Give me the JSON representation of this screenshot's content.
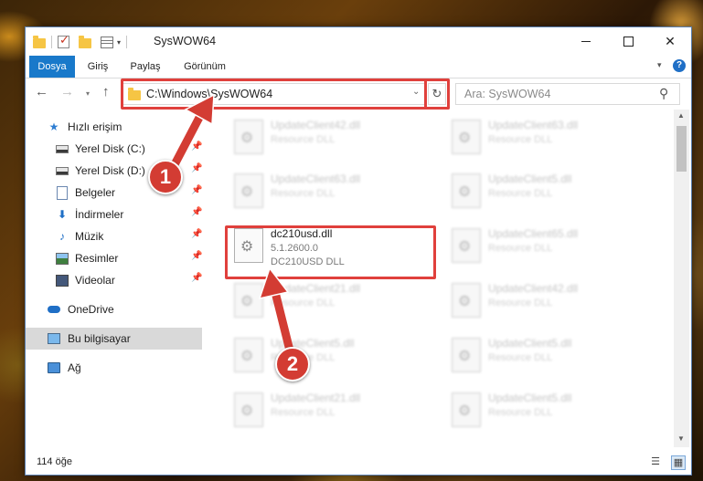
{
  "window": {
    "title": "SysWOW64"
  },
  "ribbon": {
    "tabs": [
      "Dosya",
      "Giriş",
      "Paylaş",
      "Görünüm"
    ],
    "help_label": "?"
  },
  "nav": {
    "address": "C:\\Windows\\SysWOW64",
    "search_placeholder": "Ara: SysWOW64"
  },
  "sidebar": {
    "items": [
      {
        "label": "Hızlı erişim",
        "icon": "star-icon"
      },
      {
        "label": "Yerel Disk (C:)",
        "icon": "drive-icon"
      },
      {
        "label": "Yerel Disk (D:)",
        "icon": "drive-icon"
      },
      {
        "label": "Belgeler",
        "icon": "documents-icon"
      },
      {
        "label": "İndirmeler",
        "icon": "downloads-icon"
      },
      {
        "label": "Müzik",
        "icon": "music-icon"
      },
      {
        "label": "Resimler",
        "icon": "pictures-icon"
      },
      {
        "label": "Videolar",
        "icon": "videos-icon"
      },
      {
        "label": "OneDrive",
        "icon": "onedrive-icon"
      },
      {
        "label": "Bu bilgisayar",
        "icon": "this-pc-icon"
      },
      {
        "label": "Ağ",
        "icon": "network-icon"
      }
    ]
  },
  "files": {
    "left": [
      {
        "name": "UpdateClient42.dll",
        "desc": "Resource DLL"
      },
      {
        "name": "UpdateClient63.dll",
        "desc": "Resource DLL"
      },
      {
        "name": "UpdateClient21.dll",
        "desc": "Resource DLL"
      },
      {
        "name": "UpdateClient5.dll",
        "desc": "Resource DLL"
      },
      {
        "name": "UpdateClient21.dll",
        "desc": "Resource DLL"
      }
    ],
    "right": [
      {
        "name": "UpdateClient63.dll",
        "desc": "Resource DLL"
      },
      {
        "name": "UpdateClient5.dll",
        "desc": "Resource DLL"
      },
      {
        "name": "UpdateClient65.dll",
        "desc": "Resource DLL"
      },
      {
        "name": "UpdateClient42.dll",
        "desc": "Resource DLL"
      },
      {
        "name": "UpdateClient5.dll",
        "desc": "Resource DLL"
      },
      {
        "name": "UpdateClient5.dll",
        "desc": "Resource DLL"
      }
    ],
    "highlighted": {
      "name": "dc210usd.dll",
      "version": "5.1.2600.0",
      "desc": "DC210USD DLL"
    }
  },
  "status": {
    "item_count": "114 öğe"
  },
  "annotations": {
    "step1": "1",
    "step2": "2"
  },
  "colors": {
    "highlight": "#e0403c",
    "accent": "#1979ca"
  }
}
